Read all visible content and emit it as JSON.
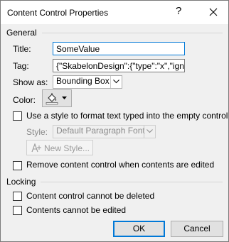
{
  "dialog": {
    "title": "Content Control Properties",
    "help_glyph": "?",
    "close_glyph": "✕"
  },
  "general": {
    "heading": "General",
    "title_label": "Title:",
    "title_value": "SomeValue",
    "tag_label": "Tag:",
    "tag_value": "{\"SkabelonDesign\":{\"type\":\"x\",\"ignor",
    "show_as_label": "Show as:",
    "show_as_value": "Bounding Box",
    "color_label": "Color:",
    "use_style_label": "Use a style to format text typed into the empty control",
    "style_label": "Style:",
    "style_value": "Default Paragraph Font",
    "new_style_label": "New Style...",
    "remove_label": "Remove content control when contents are edited"
  },
  "locking": {
    "heading": "Locking",
    "cannot_delete_label": "Content control cannot be deleted",
    "cannot_edit_label": "Contents cannot be edited"
  },
  "buttons": {
    "ok_label": "OK",
    "cancel_label": "Cancel"
  },
  "colors": {
    "focus_border": "#0078d7",
    "dialog_bg": "#f0f0f0"
  }
}
